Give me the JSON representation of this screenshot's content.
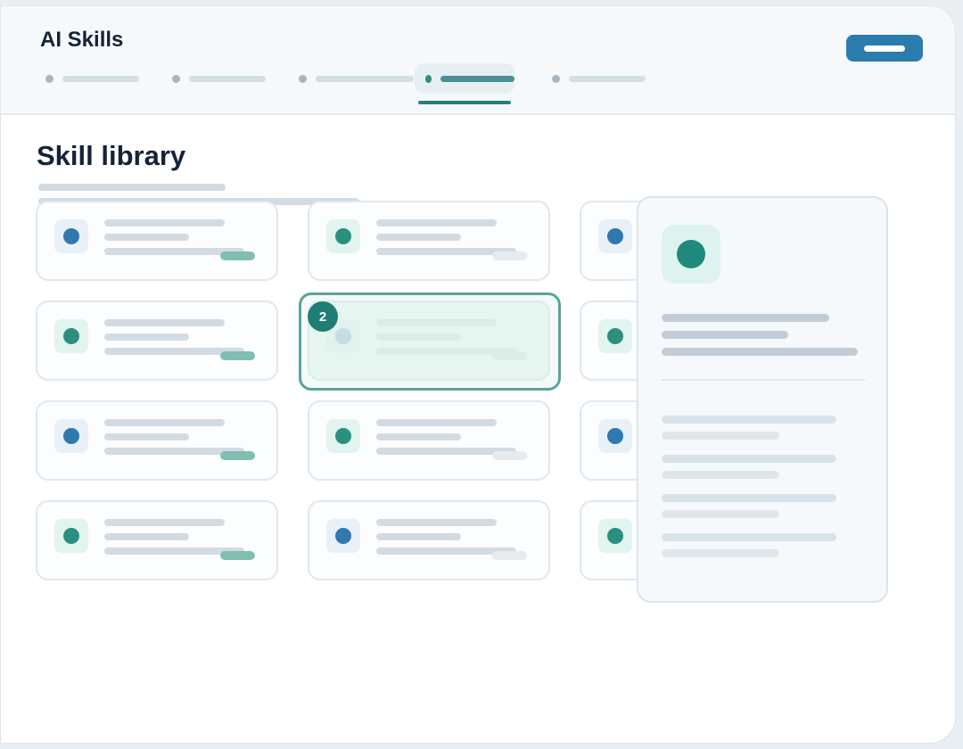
{
  "app": {
    "title": "AI Skills"
  },
  "header": {
    "primary_button": {
      "label": ""
    },
    "tabs": [
      {
        "label": "",
        "active": false
      },
      {
        "label": "",
        "active": false
      },
      {
        "label": "",
        "active": false
      },
      {
        "label": "",
        "active": true
      },
      {
        "label": "",
        "active": false
      }
    ]
  },
  "section": {
    "title": "Skill library",
    "subtitle": ""
  },
  "cards": [
    {
      "icon": "blue-dot-icon",
      "tag": "teal"
    },
    {
      "icon": "green-dot-icon",
      "tag": "grey"
    },
    {
      "icon": "blue-dot-icon",
      "tag": "grey"
    },
    {
      "icon": "green-dot-icon",
      "tag": "teal"
    },
    {
      "icon": "green-dot-icon",
      "tag": "grey",
      "dimmed": true
    },
    {
      "icon": "green-dot-icon",
      "tag": "grey"
    },
    {
      "icon": "blue-dot-icon",
      "tag": "teal"
    },
    {
      "icon": "green-dot-icon",
      "tag": "grey"
    },
    {
      "icon": "blue-dot-icon",
      "tag": "grey"
    },
    {
      "icon": "green-dot-icon",
      "tag": "teal"
    },
    {
      "icon": "blue-dot-icon",
      "tag": "grey"
    },
    {
      "icon": "green-dot-icon",
      "tag": "grey"
    }
  ],
  "drop_target": {
    "step_badge": "2"
  },
  "detail_panel": {
    "icon": "green-dot-icon"
  },
  "colors": {
    "accent_teal": "#1f8376",
    "accent_blue": "#2a7cad",
    "title_text": "#15233a"
  }
}
